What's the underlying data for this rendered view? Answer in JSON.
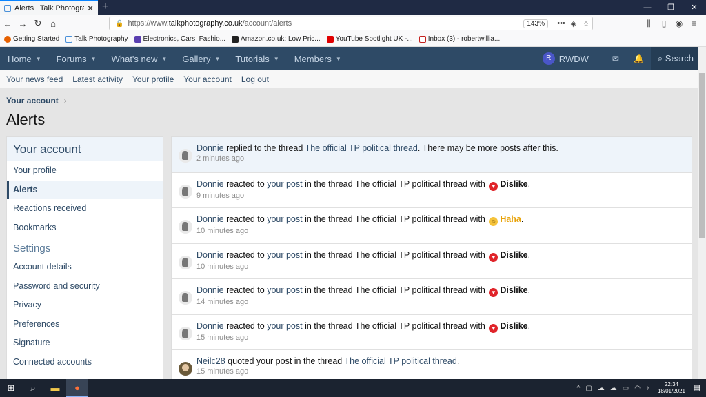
{
  "browser": {
    "tab_title": "Alerts | Talk Photography",
    "url_prefix": "https://www.",
    "url_domain": "talkphotography.co.uk",
    "url_path": "/account/alerts",
    "zoom": "143%",
    "bookmarks": [
      {
        "label": "Getting Started",
        "color": "#e66000"
      },
      {
        "label": "Talk Photography",
        "color": "#4a90d9"
      },
      {
        "label": "Electronics, Cars, Fashio...",
        "color": "#5a3fb0"
      },
      {
        "label": "Amazon.co.uk: Low Pric...",
        "color": "#222222"
      },
      {
        "label": "YouTube Spotlight UK -...",
        "color": "#e00000"
      },
      {
        "label": "Inbox (3) - robertwillia...",
        "color": "#c5221f"
      }
    ]
  },
  "site_nav": {
    "items": [
      "Home",
      "Forums",
      "What's new",
      "Gallery",
      "Tutorials",
      "Members"
    ],
    "avatar_letter": "R",
    "username": "RWDW",
    "search_label": "Search"
  },
  "sub_nav": [
    "Your news feed",
    "Latest activity",
    "Your profile",
    "Your account",
    "Log out"
  ],
  "breadcrumb": "Your account",
  "page_title": "Alerts",
  "sidebar": {
    "heading": "Your account",
    "links": [
      "Your profile",
      "Alerts",
      "Reactions received",
      "Bookmarks"
    ],
    "settings_heading": "Settings",
    "settings_links": [
      "Account details",
      "Password and security",
      "Privacy",
      "Preferences",
      "Signature",
      "Connected accounts"
    ]
  },
  "alerts": [
    {
      "user": "Donnie",
      "pre": "replied to the thread",
      "link": "The official TP political thread",
      "post": ". There may be more posts after this.",
      "time": "2 minutes ago"
    },
    {
      "user": "Donnie",
      "pre": "reacted to",
      "link": "your post",
      "post": "in the thread The official TP political thread with",
      "reaction": "Dislike",
      "time": "9 minutes ago"
    },
    {
      "user": "Donnie",
      "pre": "reacted to",
      "link": "your post",
      "post": "in the thread The official TP political thread with",
      "reaction": "Haha",
      "time": "10 minutes ago"
    },
    {
      "user": "Donnie",
      "pre": "reacted to",
      "link": "your post",
      "post": "in the thread The official TP political thread with",
      "reaction": "Dislike",
      "time": "10 minutes ago"
    },
    {
      "user": "Donnie",
      "pre": "reacted to",
      "link": "your post",
      "post": "in the thread The official TP political thread with",
      "reaction": "Dislike",
      "time": "14 minutes ago"
    },
    {
      "user": "Donnie",
      "pre": "reacted to",
      "link": "your post",
      "post": "in the thread The official TP political thread with",
      "reaction": "Dislike",
      "time": "15 minutes ago"
    },
    {
      "user": "Neilc28",
      "pre": "quoted your post in the thread",
      "link": "The official TP political thread",
      "post": ".",
      "time": "15 minutes ago"
    }
  ],
  "taskbar": {
    "time": "22:34",
    "date": "18/01/2021"
  },
  "colors": {
    "header_bg": "#2e4a66",
    "link": "#2e4a66",
    "dislike": "#e0242a",
    "haha": "#e8a30a"
  }
}
